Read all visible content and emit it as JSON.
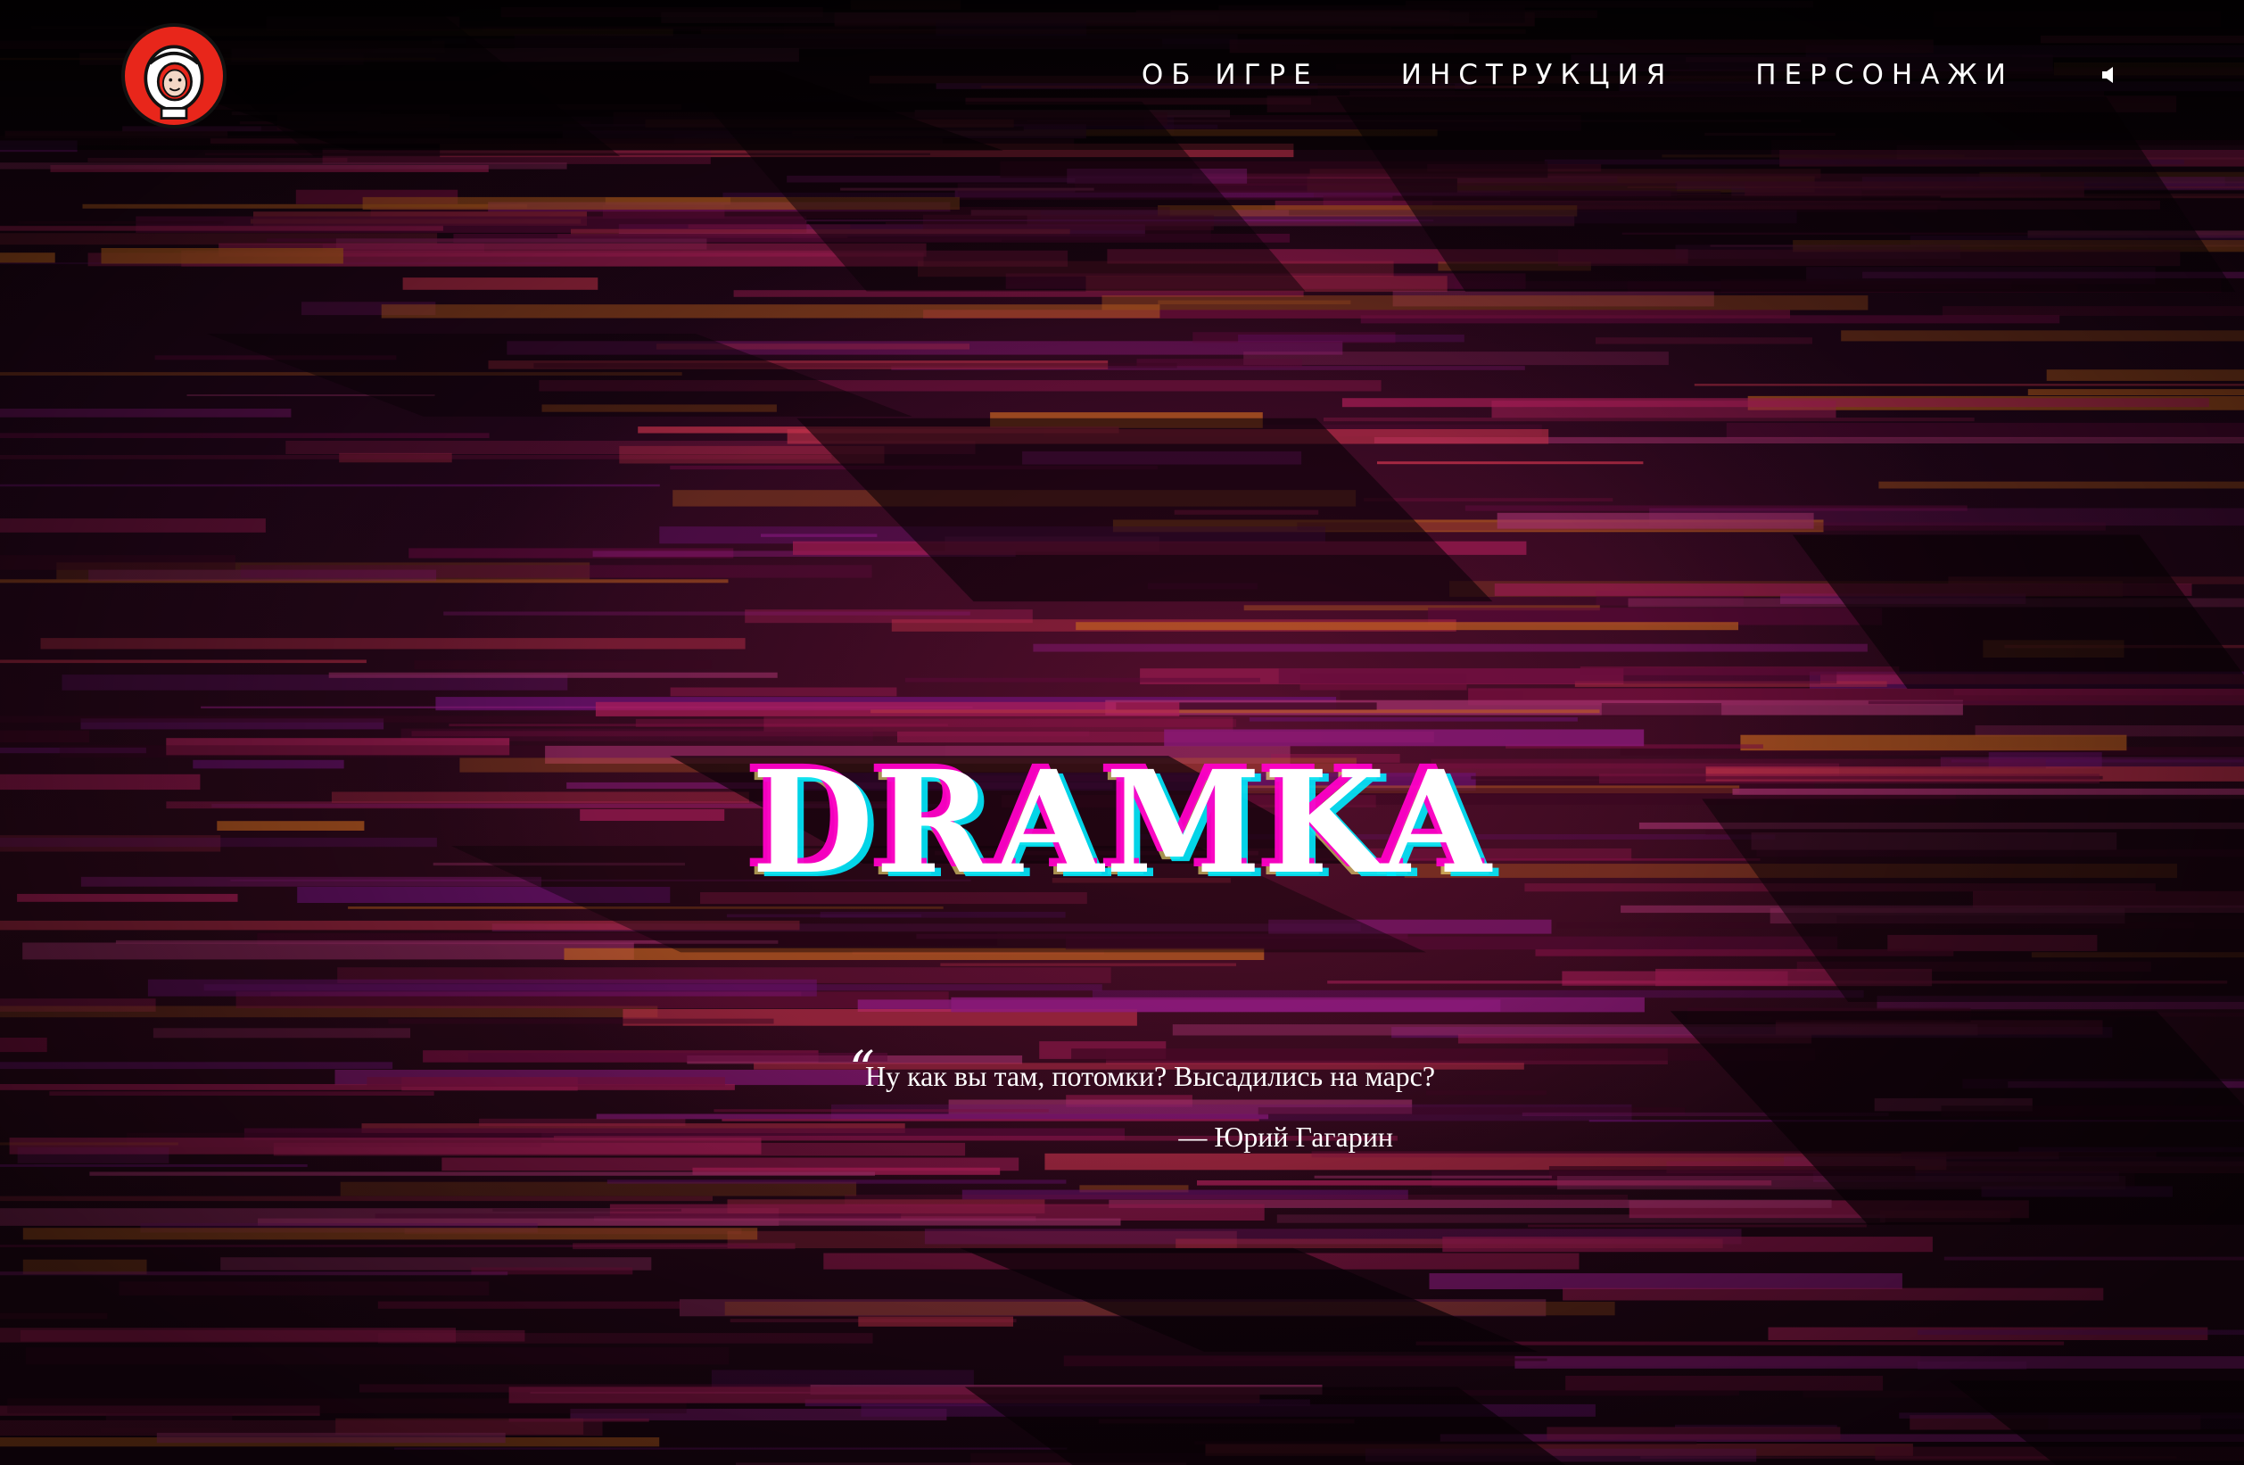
{
  "nav": {
    "items": [
      {
        "label": "ОБ ИГРЕ"
      },
      {
        "label": "ИНСТРУКЦИЯ"
      },
      {
        "label": "ПЕРСОНАЖИ"
      }
    ],
    "sound_icon": "speaker-icon"
  },
  "logo": {
    "icon": "astronaut-helmet-icon",
    "accent": "#e8261b"
  },
  "hero": {
    "title": "DRAMKA",
    "quote_mark": "“",
    "quote": "Ну как вы там, потомки? Высадились на марс?",
    "author": "— Юрий Гагарин"
  },
  "colors": {
    "glitch_magenta": "#ff00c8",
    "glitch_cyan": "#00ebff",
    "background_base": "#1a0510"
  }
}
